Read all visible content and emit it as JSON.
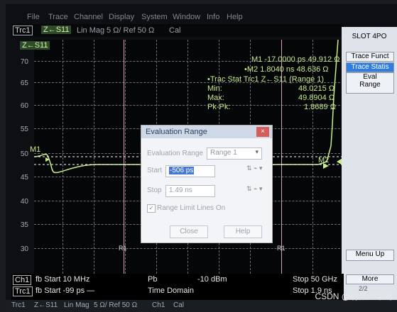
{
  "menubar": {
    "items": [
      "File",
      "Trace",
      "Channel",
      "Display",
      "System",
      "Window",
      "Info",
      "Help"
    ]
  },
  "top_right": {
    "label": "SLOT 4PO",
    "functions": [
      "Trace Funct",
      "Trace Statis"
    ],
    "eval_range": "Eval\nRange",
    "menu_up": "Menu Up",
    "more": "More",
    "page": "2/2"
  },
  "trace_header": {
    "trc": "Trc1",
    "trace": "Z←S11",
    "mode": "Lin Mag",
    "scale": "5 Ω/ Ref 50 Ω",
    "cal": "Cal"
  },
  "plot": {
    "trace_label": "Z←S11",
    "y_ticks": [
      "70",
      "65",
      "60",
      "55",
      "50",
      "45",
      "40",
      "35",
      "30"
    ],
    "marker_labels": [
      "M1",
      "M2"
    ],
    "marker_m1": "M1   -17.0000 ps   49.912 Ω",
    "marker_m2": "•M2     1.8040 ns   48.636 Ω",
    "stats_title": "•Trac Stat Trc1 Z←S11 (Range 1)",
    "stats_min_label": "Min:",
    "stats_min_value": "48.0215 Ω",
    "stats_max_label": "Max:",
    "stats_max_value": "49.8904 Ω",
    "stats_pk_label": "Pk-Pk:",
    "stats_pk_value": "1.8689 Ω",
    "r1_label": "R1"
  },
  "dialog": {
    "title": "Evaluation Range",
    "evaluation_range_label": "Evaluation Range",
    "evaluation_range_value": "Range 1",
    "start_label": "Start",
    "start_value": "-506 ps",
    "stop_label": "Stop",
    "stop_value": "1.49 ns",
    "checkbox_label": "Range Limit Lines On",
    "close_button": "Close",
    "help_button": "Help"
  },
  "bottom": {
    "ch1": "Ch1",
    "trc1": "Trc1",
    "fb_start_1": "fb  Start  10 MHz",
    "fb_start_2": "fb  Start  -99 ps   —",
    "pb": "Pb",
    "power": "-10 dBm",
    "time_domain": "Time Domain",
    "stop_1": "Stop  50 GHz",
    "stop_2": "Stop  1.9 ns"
  },
  "footer": {
    "trc": "Trc1",
    "trace": "Z←S11",
    "mode": "Lin Mag",
    "scale": "5 Ω/ Ref 50 Ω",
    "ch": "Ch1",
    "cal": "Cal"
  },
  "watermark": "CSDN @射频老菜鸟"
}
